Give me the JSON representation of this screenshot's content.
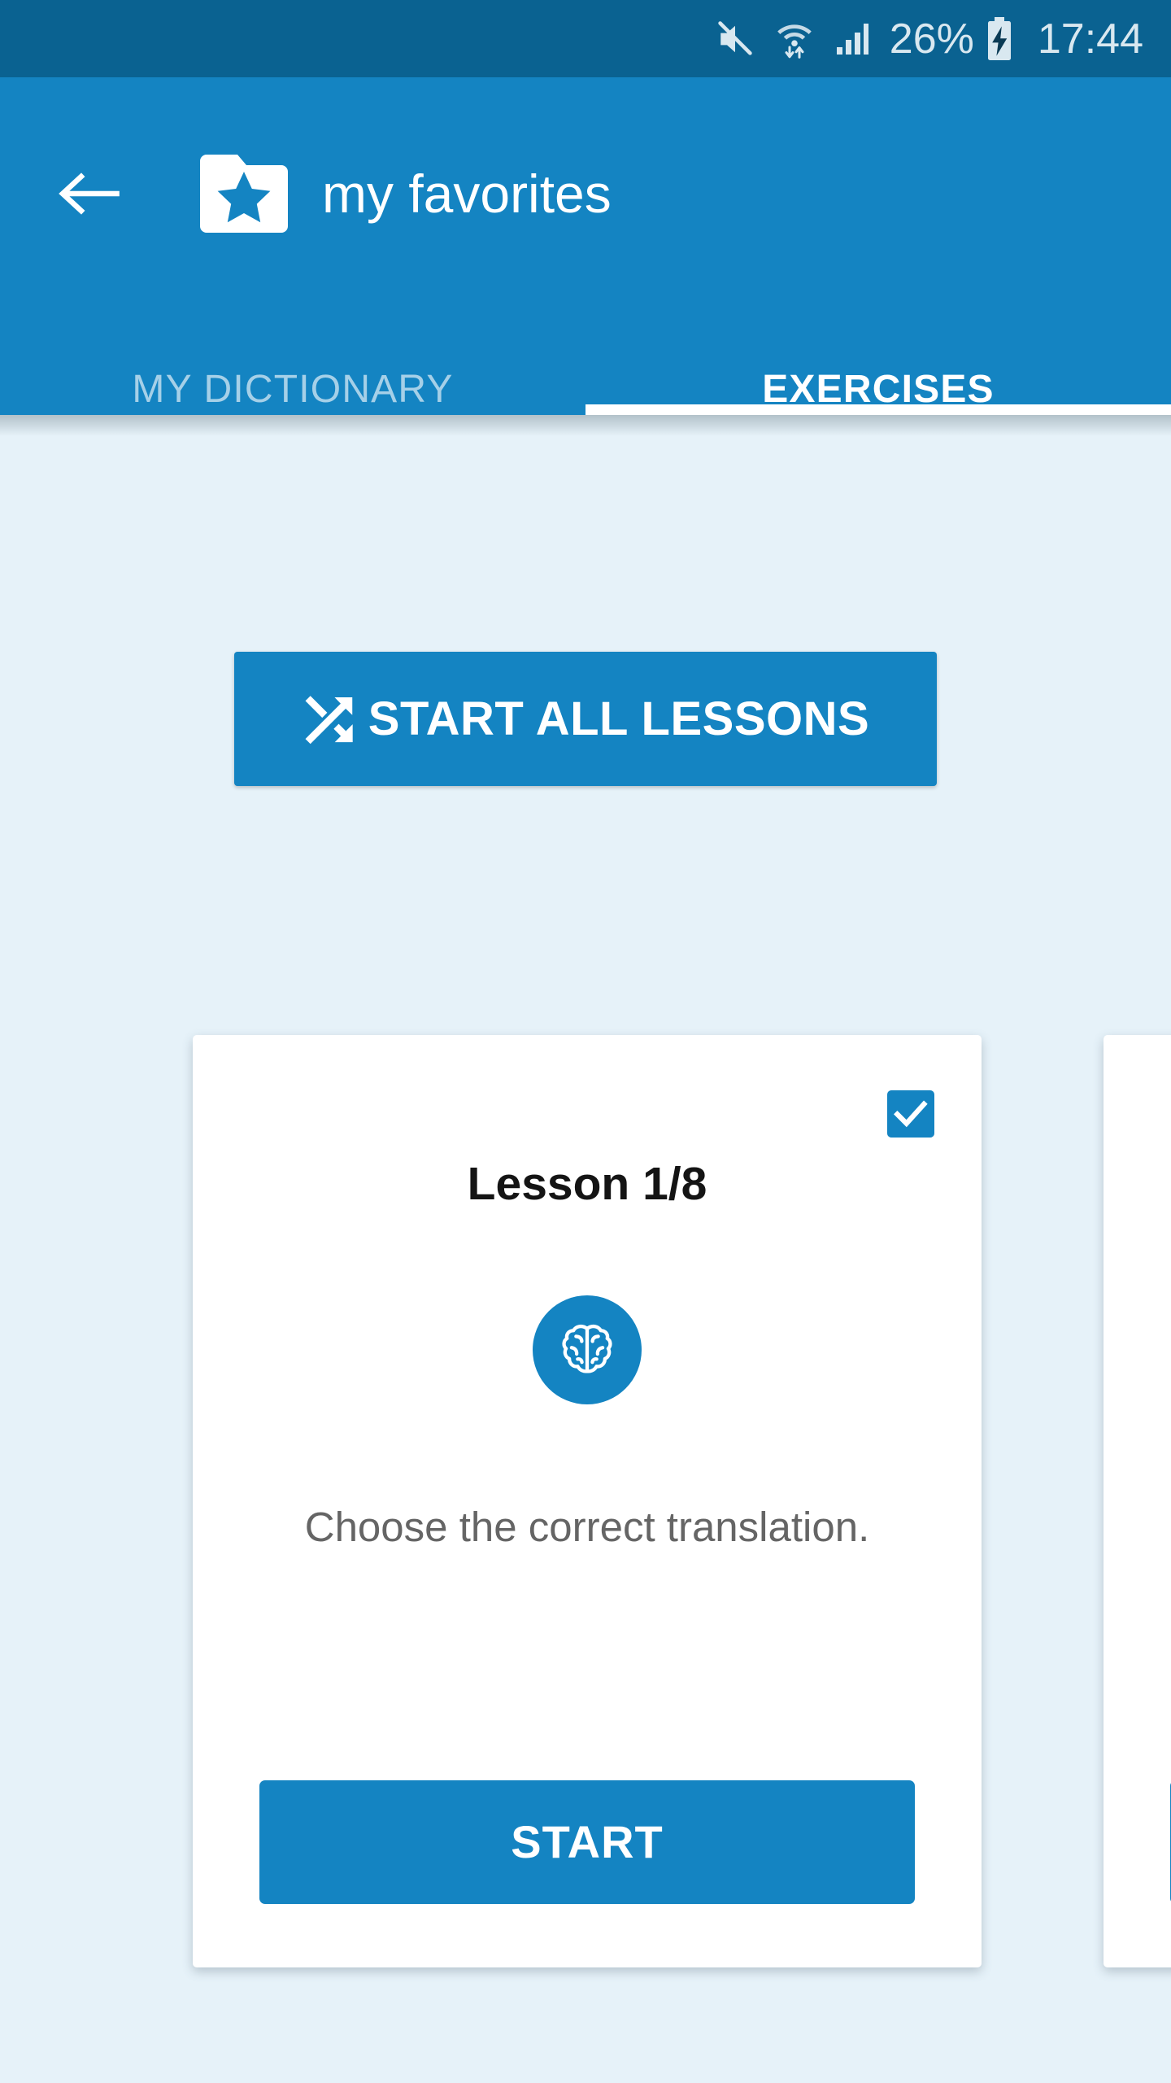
{
  "status_bar": {
    "mute_icon": "mute-icon",
    "wifi_icon": "wifi-icon",
    "cellular_icon": "cellular-signal-icon",
    "battery_percent": "26%",
    "battery_icon": "battery-charging-icon",
    "time": "17:44"
  },
  "app_bar": {
    "back_icon": "back-arrow-icon",
    "folder_icon": "folder-star-icon",
    "title": "my favorites",
    "background_color": "#1484c2"
  },
  "tabs": [
    {
      "label": "MY DICTIONARY",
      "active": false
    },
    {
      "label": "EXERCISES",
      "active": true
    }
  ],
  "content": {
    "background_color": "#e6f2f9",
    "start_all_lessons": {
      "label": "START ALL LESSONS",
      "icon": "shuffle-icon",
      "color": "#1484c2"
    },
    "cards": [
      {
        "title": "Lesson 1/8",
        "icon": "brain-icon",
        "description": "Choose the correct translation.",
        "start_label": "START",
        "checked": true,
        "accent_color": "#1484c2"
      },
      {
        "title": "",
        "icon": "brain-icon",
        "description": "",
        "start_label": "",
        "checked": false,
        "accent_color": "#1484c2"
      }
    ]
  }
}
